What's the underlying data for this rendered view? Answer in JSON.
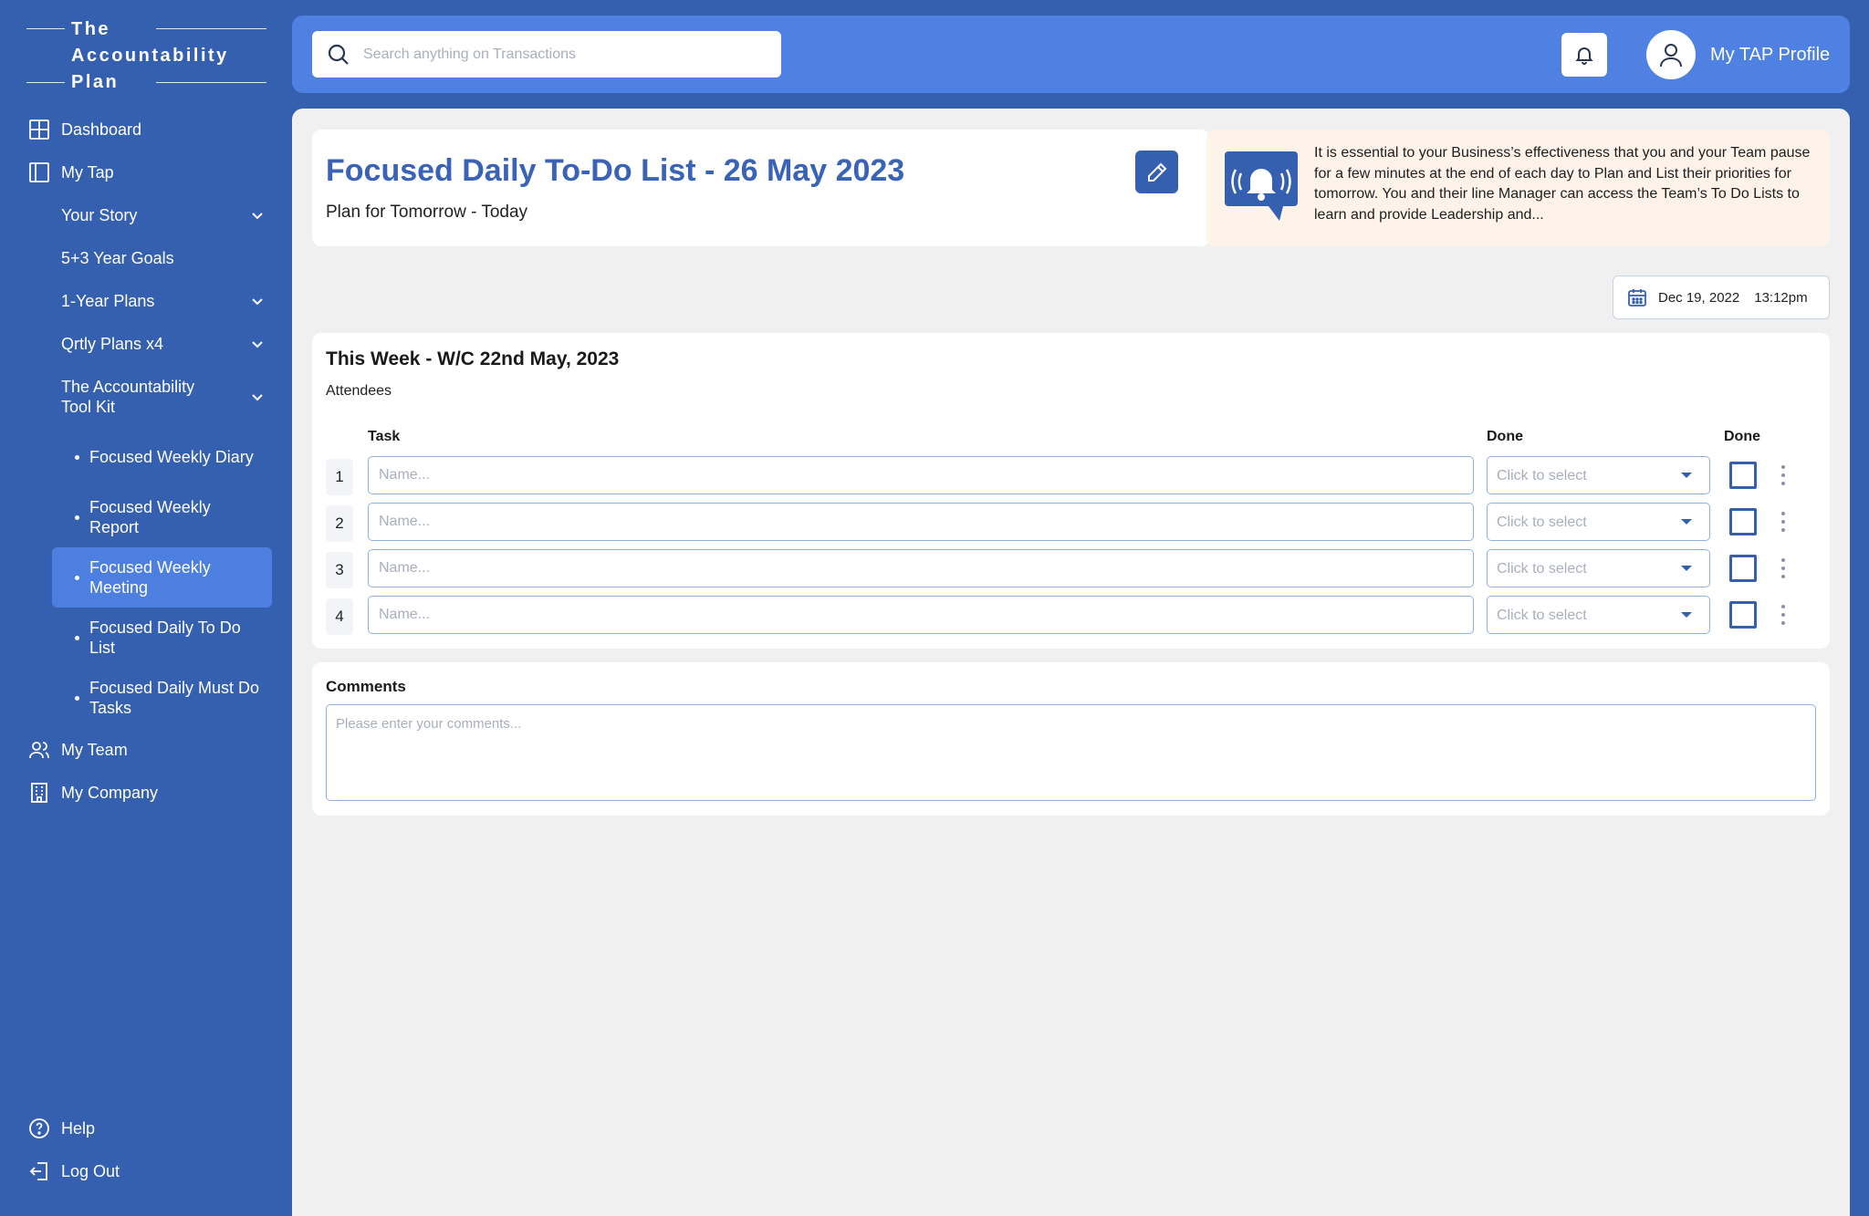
{
  "brand": {
    "logo_text": "The\nAccountability\nPlan"
  },
  "colors": {
    "sidebar": "#3560b0",
    "topbar": "#4f81e2",
    "active_item": "#4d7fe0",
    "title": "#3a63b8",
    "notice_bg": "#fdf3e8"
  },
  "sidebar": {
    "items": [
      {
        "label": "Dashboard",
        "icon": "grid-icon"
      },
      {
        "label": "My Tap",
        "icon": "panel-icon"
      },
      {
        "label": "Your Story",
        "icon": "chevron-down-icon"
      },
      {
        "label": "5+3 Year Goals"
      },
      {
        "label": "1-Year Plans",
        "icon": "chevron-down-icon"
      },
      {
        "label": "Qrtly Plans x4",
        "icon": "chevron-down-icon"
      },
      {
        "label": "The Accountability Tool Kit",
        "icon": "chevron-down-icon"
      },
      {
        "label": "Focused Weekly Diary"
      },
      {
        "label": "Focused Weekly Report"
      },
      {
        "label": "Focused Weekly Meeting",
        "active": true
      },
      {
        "label": "Focused Daily To Do List"
      },
      {
        "label": "Focused Daily Must Do Tasks"
      },
      {
        "label": "My Team",
        "icon": "users-icon"
      },
      {
        "label": "My Company",
        "icon": "building-icon"
      }
    ],
    "bottom": [
      {
        "label": "Help",
        "icon": "help-icon"
      },
      {
        "label": "Log Out",
        "icon": "logout-icon"
      }
    ]
  },
  "header": {
    "search_placeholder": "Search anything on Transactions",
    "profile_label": "My TAP Profile"
  },
  "page": {
    "title": "Focused Daily To-Do List - 26 May 2023",
    "subtitle": "Plan for Tomorrow - Today",
    "notice": "It is essential to your Business’s effectiveness that you and your Team pause for a few minutes at the end of each day to Plan and List their priorities for tomorrow. You and their line Manager can access the Team’s To Do Lists to learn and provide Leadership and...",
    "date": "Dec 19, 2022",
    "time": "13:12pm"
  },
  "week": {
    "title": "This Week - W/C 22nd May, 2023",
    "attendees_label": "Attendees",
    "headers": {
      "task": "Task",
      "done1": "Done",
      "done2": "Done"
    },
    "rows": [
      {
        "num": "1",
        "placeholder": "Name...",
        "select": "Click to select"
      },
      {
        "num": "2",
        "placeholder": "Name...",
        "select": "Click to select"
      },
      {
        "num": "3",
        "placeholder": "Name...",
        "select": "Click to select"
      },
      {
        "num": "4",
        "placeholder": "Name...",
        "select": "Click to select"
      }
    ]
  },
  "comments": {
    "label": "Comments",
    "placeholder": "Please enter your comments..."
  }
}
